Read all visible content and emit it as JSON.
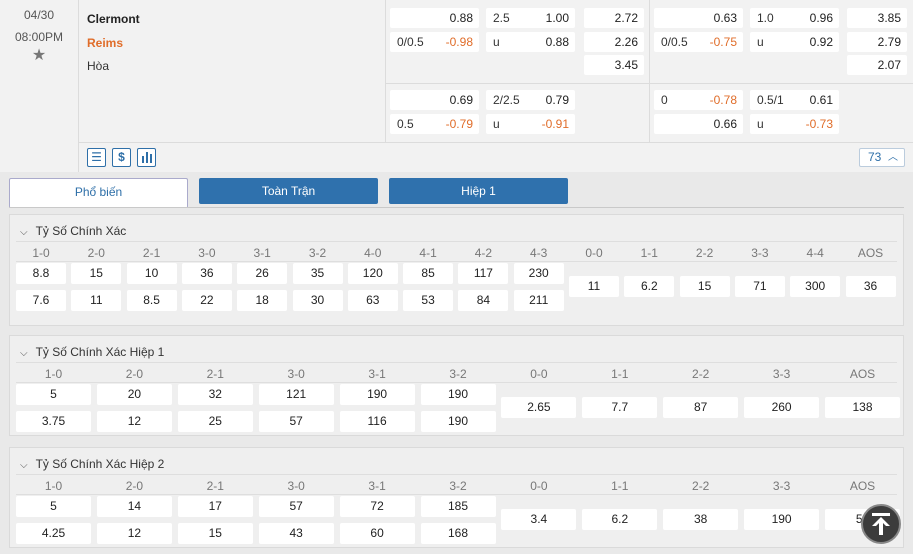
{
  "match": {
    "date": "04/30",
    "time": "08:00PM",
    "home": "Clermont",
    "away": "Reims",
    "draw": "Hòa",
    "count": "73"
  },
  "odds": {
    "full_ah": {
      "hdp": "0/0.5",
      "home": "0.88",
      "away": "-0.98"
    },
    "full_ou": {
      "line": "2.5",
      "over": "1.00",
      "u": "u",
      "under": "0.88"
    },
    "full_1x2": {
      "home": "2.72",
      "away": "2.26",
      "draw": "3.45"
    },
    "full_ah2": {
      "hdp": "0.5",
      "home": "0.69",
      "away": "-0.79"
    },
    "full_ou2": {
      "line": "2/2.5",
      "over": "0.79",
      "u": "u",
      "under": "-0.91"
    },
    "h1_ah": {
      "hdp": "0/0.5",
      "home": "0.63",
      "away": "-0.75"
    },
    "h1_ou": {
      "line": "1.0",
      "over": "0.96",
      "u": "u",
      "under": "0.92"
    },
    "h1_1x2": {
      "home": "3.85",
      "away": "2.79",
      "draw": "2.07"
    },
    "h1_ah2": {
      "hdp": "0",
      "home": "-0.78",
      "away": "0.66"
    },
    "h1_ou2": {
      "line": "0.5/1",
      "over": "0.61",
      "u": "u",
      "under": "-0.73"
    }
  },
  "icons": [
    "list-icon",
    "dollar-icon",
    "bar-chart-icon",
    "chevron-up-icon",
    "arrow-up-icon"
  ],
  "tabs": [
    "Phổ biến",
    "Toàn Trận",
    "Hiệp 1"
  ],
  "sections": [
    {
      "title": "Tỷ Số Chính Xác",
      "headers": [
        "1-0",
        "2-0",
        "2-1",
        "3-0",
        "3-1",
        "3-2",
        "4-0",
        "4-1",
        "4-2",
        "4-3",
        "0-0",
        "1-1",
        "2-2",
        "3-3",
        "4-4",
        "AOS"
      ],
      "home": [
        "8.8",
        "15",
        "10",
        "36",
        "26",
        "35",
        "120",
        "85",
        "117",
        "230"
      ],
      "away": [
        "7.6",
        "11",
        "8.5",
        "22",
        "18",
        "30",
        "63",
        "53",
        "84",
        "211"
      ],
      "draws": [
        "11",
        "6.2",
        "15",
        "71",
        "300",
        "36"
      ]
    },
    {
      "title": "Tỷ Số Chính Xác Hiệp 1",
      "headers": [
        "1-0",
        "2-0",
        "2-1",
        "3-0",
        "3-1",
        "3-2",
        "0-0",
        "1-1",
        "2-2",
        "3-3",
        "AOS"
      ],
      "home": [
        "5",
        "20",
        "32",
        "121",
        "190",
        "190"
      ],
      "away": [
        "3.75",
        "12",
        "25",
        "57",
        "116",
        "190"
      ],
      "draws": [
        "2.65",
        "7.7",
        "87",
        "260",
        "138"
      ]
    },
    {
      "title": "Tỷ Số Chính Xác Hiệp 2",
      "headers": [
        "1-0",
        "2-0",
        "2-1",
        "3-0",
        "3-1",
        "3-2",
        "0-0",
        "1-1",
        "2-2",
        "3-3",
        "AOS"
      ],
      "home": [
        "5",
        "14",
        "17",
        "57",
        "72",
        "185"
      ],
      "away": [
        "4.25",
        "12",
        "15",
        "43",
        "60",
        "168"
      ],
      "draws": [
        "3.4",
        "6.2",
        "38",
        "190",
        "53"
      ]
    }
  ],
  "colors": {
    "accent": "#2f71ad",
    "negative": "#e06d2a",
    "away_team": "#e06d2a"
  }
}
